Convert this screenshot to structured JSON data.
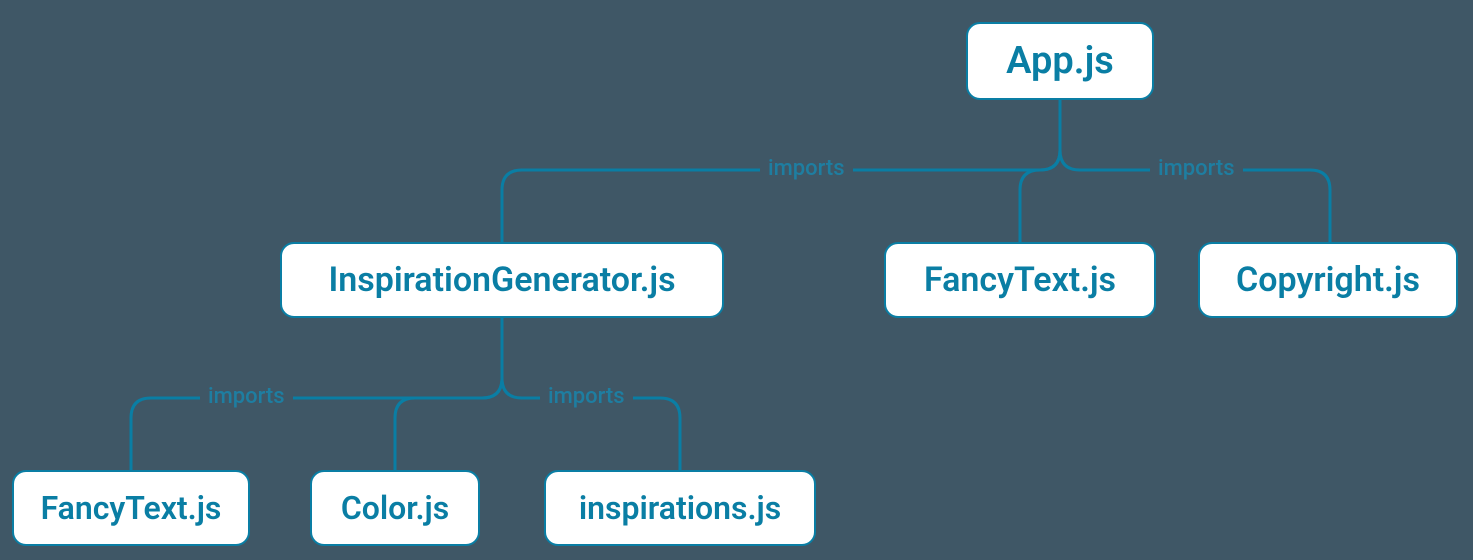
{
  "diagram": {
    "type": "module-dependency-tree",
    "colors": {
      "stroke": "#0a7ea4",
      "node_bg": "#ffffff",
      "node_text": "#0a7ea4",
      "canvas_bg": "#3f5766",
      "edge_label": "#1e7ea1"
    },
    "nodes": {
      "app": {
        "label": "App.js"
      },
      "inspgen": {
        "label": "InspirationGenerator.js"
      },
      "fancytext_top": {
        "label": "FancyText.js"
      },
      "copyright": {
        "label": "Copyright.js"
      },
      "fancytext_bot": {
        "label": "FancyText.js"
      },
      "color": {
        "label": "Color.js"
      },
      "inspirations": {
        "label": "inspirations.js"
      }
    },
    "edges": {
      "e1": {
        "from": "app",
        "to": "inspgen",
        "label": "imports"
      },
      "e2": {
        "from": "app",
        "to": "fancytext_top",
        "label": ""
      },
      "e3": {
        "from": "app",
        "to": "copyright",
        "label": "imports"
      },
      "e4": {
        "from": "inspgen",
        "to": "fancytext_bot",
        "label": "imports"
      },
      "e5": {
        "from": "inspgen",
        "to": "color",
        "label": ""
      },
      "e6": {
        "from": "inspgen",
        "to": "inspirations",
        "label": "imports"
      }
    }
  }
}
